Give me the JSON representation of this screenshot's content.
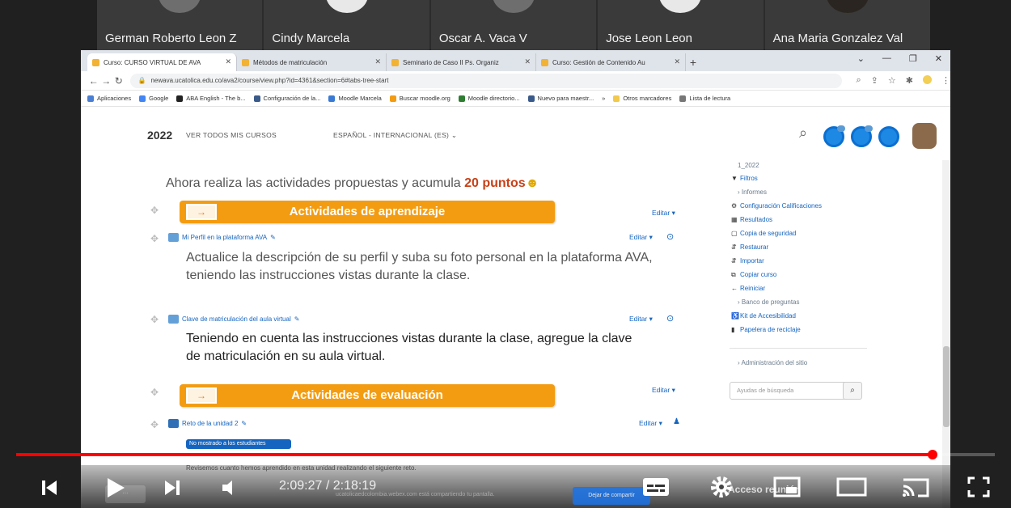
{
  "participants": [
    {
      "name": "German Roberto Leon Z"
    },
    {
      "name": "Cindy Marcela"
    },
    {
      "name": "Oscar A. Vaca V"
    },
    {
      "name": "Jose Leon Leon"
    },
    {
      "name": "Ana Maria Gonzalez Val"
    }
  ],
  "browser": {
    "tabs": [
      {
        "title": "Curso: CURSO VIRTUAL DE AVA"
      },
      {
        "title": "Métodos de matriculación"
      },
      {
        "title": "Seminario de Caso II Ps. Organiz"
      },
      {
        "title": "Curso: Gestión de Contenido Au"
      }
    ],
    "new_tab": "+",
    "url": "newava.ucatolica.edu.co/ava2/course/view.php?id=4361&section=6#tabs-tree-start",
    "bookmarks": [
      {
        "label": "Aplicaciones"
      },
      {
        "label": "Google"
      },
      {
        "label": "ABA English - The b..."
      },
      {
        "label": "Configuración de la..."
      },
      {
        "label": "Moodle Marcela"
      },
      {
        "label": "Buscar moodle.org"
      },
      {
        "label": "Moodle directorio..."
      },
      {
        "label": "Nuevo para maestr..."
      },
      {
        "label": "»"
      },
      {
        "label": "Otros marcadores"
      },
      {
        "label": "Lista de lectura"
      }
    ]
  },
  "moodle": {
    "brand": "2022",
    "nav_all_courses": "VER TODOS MIS CURSOS",
    "nav_language": "ESPAÑOL - INTERNACIONAL (ES) ⌄",
    "intro_text": "Ahora realiza las actividades propuestas y acumula",
    "intro_points": "20 puntos",
    "section1": "Actividades de aprendizaje",
    "section2": "Actividades de evaluación",
    "editar": "Editar ▾",
    "activity1": "Mi Perfil en la plataforma AVA",
    "activity1_desc_line1": "Actualice la descripción de su perfil  y  suba su foto personal  en la plataforma AVA,",
    "activity1_desc_line2": "teniendo las instrucciones vistas durante la clase.",
    "activity2": "Clave de matriculación del aula virtual",
    "activity2_desc_line1": "Teniendo en cuenta las instrucciones vistas durante la clase, agregue la clave",
    "activity2_desc_line2": "de matriculación en su aula virtual.",
    "activity3": "Reto de la unidad 2",
    "hidden_badge": "No mostrado a los estudiantes",
    "activity3_desc": "Revisemos cuanto hemos aprendido en esta unidad realizando el siguiente reto."
  },
  "admin_block": {
    "items": [
      {
        "label": "1_2022",
        "icon": "",
        "sub": true
      },
      {
        "label": "Filtros",
        "icon": "▼",
        "sub": false
      },
      {
        "label": "› Informes",
        "icon": "",
        "sub": true
      },
      {
        "label": "Configuración Calificaciones",
        "icon": "⚙",
        "sub": false
      },
      {
        "label": "Resultados",
        "icon": "▦",
        "sub": false
      },
      {
        "label": "Copia de seguridad",
        "icon": "▢",
        "sub": false
      },
      {
        "label": "Restaurar",
        "icon": "⇵",
        "sub": false
      },
      {
        "label": "Importar",
        "icon": "⇵",
        "sub": false
      },
      {
        "label": "Copiar curso",
        "icon": "⧉",
        "sub": false
      },
      {
        "label": "Reiniciar",
        "icon": "←",
        "sub": false
      },
      {
        "label": "› Banco de preguntas",
        "icon": "",
        "sub": true
      },
      {
        "label": "Kit de Accesibilidad",
        "icon": "♿",
        "sub": false
      },
      {
        "label": "Papelera de reciclaje",
        "icon": "🗑",
        "sub": false
      }
    ],
    "admin_site": "› Administración del sitio",
    "search_placeholder": "Ayudas de búsqueda",
    "search_icon": "search-icon"
  },
  "overlay": {
    "sharing_text": "ucatolicaedcolombia.webex.com está compartiendo tu pantalla.",
    "stop_sharing": "Dejar de compartir",
    "acceso": "Acceso     reunión"
  },
  "player": {
    "time_text": "2:09:27 / 2:18:19",
    "progress": 0.936,
    "accent": "#ff0000"
  }
}
